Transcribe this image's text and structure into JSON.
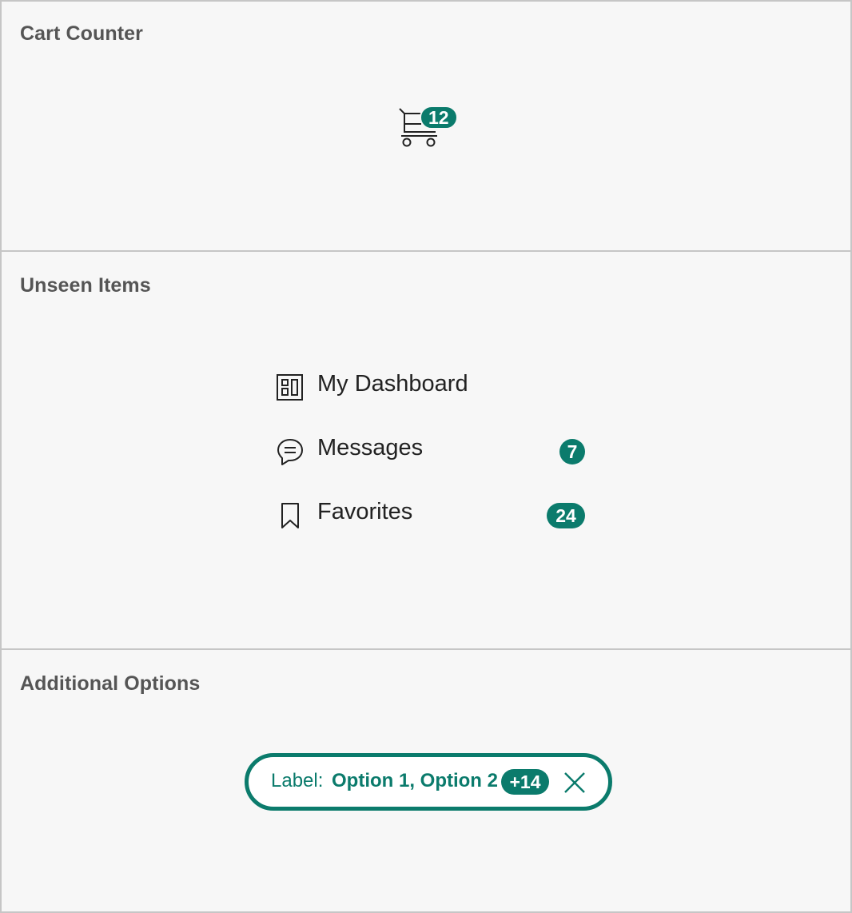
{
  "accent_color": "#0b7b6c",
  "sections": {
    "cart_counter": {
      "title": "Cart Counter",
      "cart_icon": "shopping-cart-icon",
      "count": "12"
    },
    "unseen_items": {
      "title": "Unseen Items",
      "items": [
        {
          "label": "My Dashboard",
          "icon": "dashboard-icon",
          "badge": ""
        },
        {
          "label": "Messages",
          "icon": "chat-bubble-icon",
          "badge": "7"
        },
        {
          "label": "Favorites",
          "icon": "bookmark-icon",
          "badge": "24"
        }
      ]
    },
    "additional_options": {
      "title": "Additional Options",
      "chip": {
        "label": "Label:",
        "value": "Option 1, Option 2",
        "extra_count": "+14",
        "close_icon": "close-icon"
      }
    }
  }
}
